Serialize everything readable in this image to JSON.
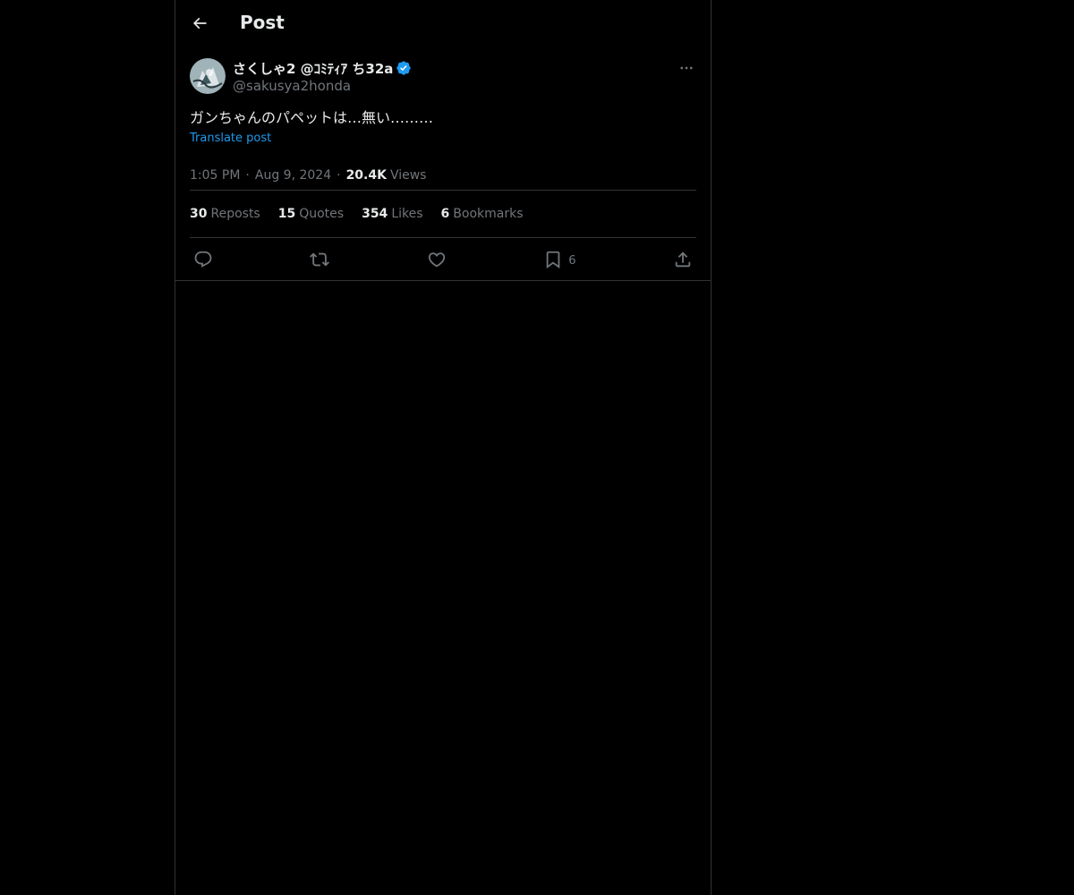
{
  "header": {
    "title": "Post",
    "back_icon": "arrow-left-icon"
  },
  "author": {
    "display_name": "さくしゃ2 @ｺﾐﾃｨｱ ち32a",
    "handle": "@sakusya2honda",
    "verified": true,
    "verified_color": "#1d9bf0"
  },
  "post": {
    "text": "ガンちゃんのパペットは…無い………",
    "translate_label": "Translate post",
    "time": "1:05 PM",
    "date": "Aug 9, 2024",
    "views_count": "20.4K",
    "views_label": "Views",
    "separator": "·"
  },
  "stats": [
    {
      "count": "30",
      "label": "Reposts"
    },
    {
      "count": "15",
      "label": "Quotes"
    },
    {
      "count": "354",
      "label": "Likes"
    },
    {
      "count": "6",
      "label": "Bookmarks"
    }
  ],
  "actions": {
    "reply_icon": "reply-icon",
    "repost_icon": "repost-icon",
    "like_icon": "like-icon",
    "bookmark_icon": "bookmark-icon",
    "bookmark_count": "6",
    "share_icon": "share-icon"
  },
  "colors": {
    "background": "#000000",
    "text_primary": "#e7e9ea",
    "text_secondary": "#71767b",
    "accent": "#1d9bf0",
    "border": "#2f3336"
  }
}
